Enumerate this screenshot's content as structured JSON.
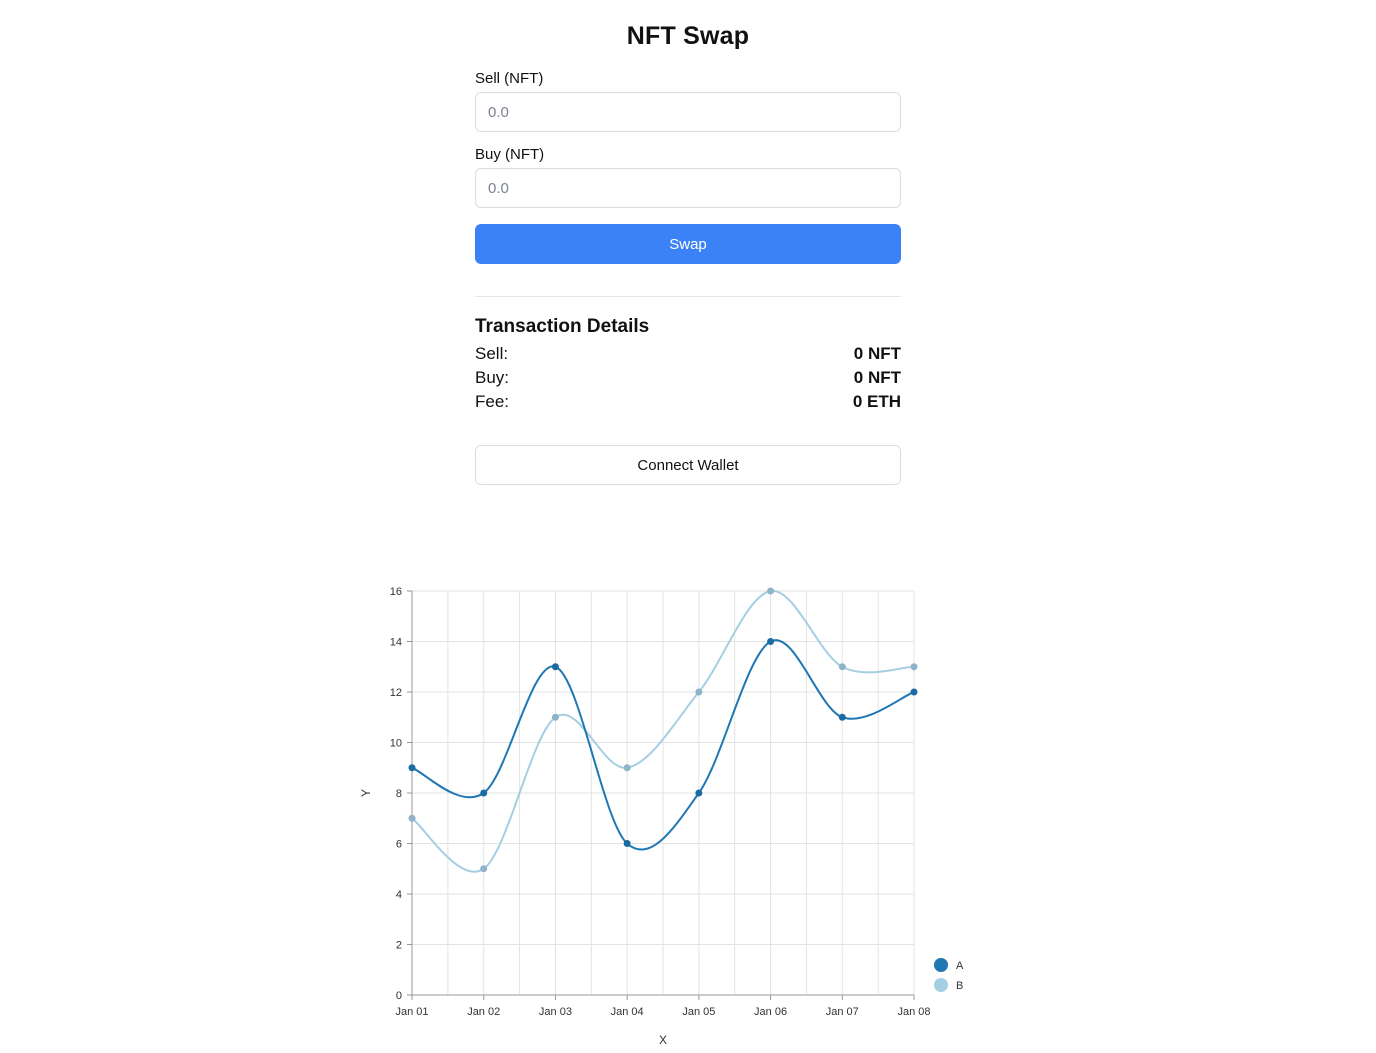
{
  "app": {
    "title": "NFT Swap"
  },
  "form": {
    "sell_label": "Sell (NFT)",
    "sell_placeholder": "0.0",
    "buy_label": "Buy (NFT)",
    "buy_placeholder": "0.0",
    "swap_label": "Swap"
  },
  "transaction": {
    "title": "Transaction Details",
    "rows": [
      {
        "label": "Sell:",
        "value": "0 NFT"
      },
      {
        "label": "Buy:",
        "value": "0 NFT"
      },
      {
        "label": "Fee:",
        "value": "0 ETH"
      }
    ]
  },
  "wallet": {
    "connect_label": "Connect Wallet"
  },
  "colors": {
    "accent": "#3b82f6",
    "series_a": "#1f77b4",
    "series_b": "#a6cee3"
  },
  "chart_data": {
    "type": "line",
    "title": "",
    "xlabel": "X",
    "ylabel": "Y",
    "categories": [
      "Jan 01",
      "Jan 02",
      "Jan 03",
      "Jan 04",
      "Jan 05",
      "Jan 06",
      "Jan 07",
      "Jan 08"
    ],
    "ylim": [
      0,
      16
    ],
    "yticks": [
      0,
      2,
      4,
      6,
      8,
      10,
      12,
      14,
      16
    ],
    "grid": true,
    "legend_position": "bottom-right",
    "series": [
      {
        "name": "A",
        "color": "#1f77b4",
        "values": [
          9,
          8,
          13,
          6,
          8,
          14,
          11,
          12
        ]
      },
      {
        "name": "B",
        "color": "#a6cee3",
        "values": [
          7,
          5,
          11,
          9,
          12,
          16,
          13,
          13
        ]
      }
    ]
  }
}
